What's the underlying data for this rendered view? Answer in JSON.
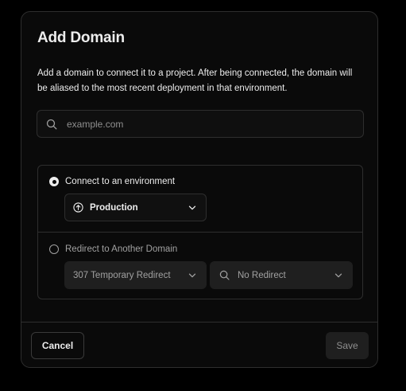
{
  "dialog": {
    "title": "Add Domain",
    "description": "Add a domain to connect it to a project. After being connected, the domain will be aliased to the most recent deployment in that environment."
  },
  "domain_input": {
    "value": "",
    "placeholder": "example.com",
    "icon": "search-icon"
  },
  "options": {
    "connect": {
      "label": "Connect to an environment",
      "checked": true,
      "environment": {
        "selected": "Production",
        "icon": "arrow-up-circle-icon"
      }
    },
    "redirect": {
      "label": "Redirect to Another Domain",
      "checked": false,
      "status_code": {
        "selected": "307 Temporary Redirect"
      },
      "target": {
        "selected": "No Redirect",
        "icon": "search-icon"
      }
    }
  },
  "footer": {
    "cancel_label": "Cancel",
    "save_label": "Save"
  },
  "colors": {
    "background": "#000000",
    "surface": "#0a0a0a",
    "border": "#2e2e2e",
    "text": "#ededed",
    "muted_text": "#a1a1a1",
    "disabled_fill": "#1f1f1f"
  }
}
